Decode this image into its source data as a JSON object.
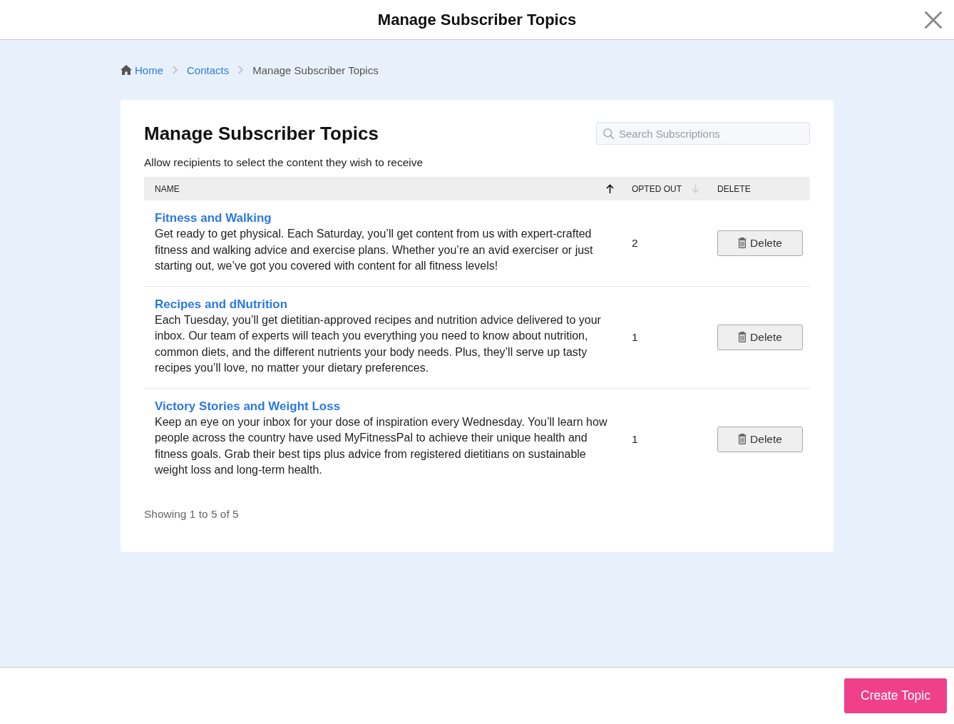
{
  "window": {
    "title": "Manage Subscriber Topics"
  },
  "breadcrumb": [
    {
      "label": "Home",
      "kind": "home"
    },
    {
      "label": "Contacts",
      "kind": "link"
    },
    {
      "label": "Manage Subscriber Topics",
      "kind": "current"
    }
  ],
  "card": {
    "title": "Manage Subscriber Topics",
    "subtitle": "Allow recipients to select the content they wish to receive",
    "search": {
      "placeholder": "Search Subscriptions"
    }
  },
  "table": {
    "columns": [
      {
        "label": "NAME",
        "kind": "ascending",
        "sort_active": true
      },
      {
        "label": "OPTED OUT",
        "kind": "descending",
        "sort_active": false
      },
      {
        "label": "DELETE",
        "kind": "plain"
      }
    ],
    "rows": [
      {
        "name": "Fitness and Walking",
        "description": "Get ready to get physical. Each Saturday, you’ll get content from us with expert-crafted fitness and walking advice and exercise plans. Whether you’re an avid exerciser or just starting out, we’ve got you covered with content for all fitness levels!",
        "opted_out": "2",
        "action": "Delete"
      },
      {
        "name": "Recipes and dNutrition",
        "description": "Each Tuesday, you’ll get dietitian-approved recipes and nutrition advice delivered to your inbox. Our team of experts will teach you everything you need to know about nutrition, common diets, and the different nutrients your body needs. Plus, they’ll serve up tasty recipes you’ll love, no matter your dietary preferences.",
        "opted_out": "1",
        "action": "Delete"
      },
      {
        "name": "Victory Stories and Weight Loss",
        "description": "Keep an eye on your inbox for your dose of inspiration every Wednesday. You’ll learn how people across the country have used MyFitnessPal to achieve their unique health and fitness goals. Grab their best tips plus advice from registered dietitians on sustainable weight loss and long-term health.",
        "opted_out": "1",
        "action": "Delete"
      }
    ]
  },
  "pagination": {
    "summary": "Showing 1 to 5 of 5"
  },
  "footer": {
    "button": "Create Topic"
  }
}
